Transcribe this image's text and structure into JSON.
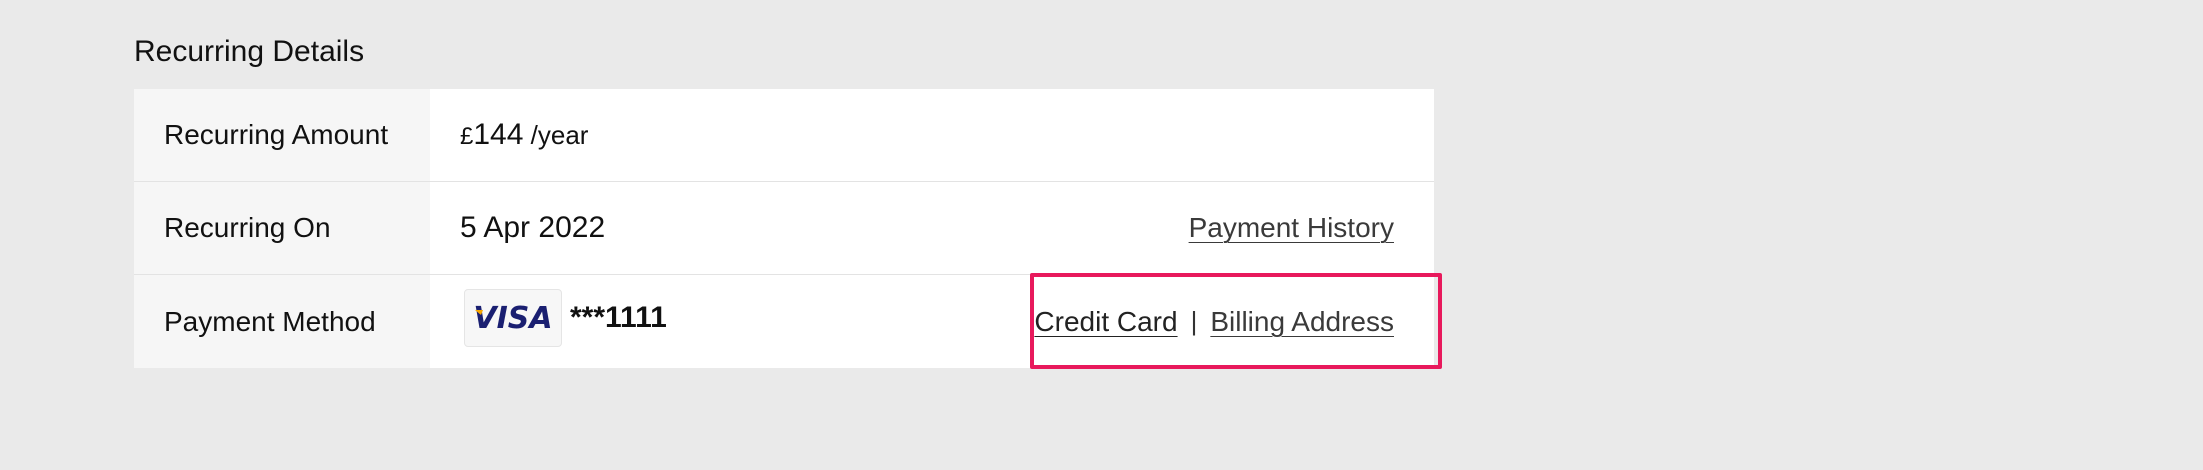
{
  "section": {
    "title": "Recurring Details"
  },
  "rows": {
    "amount": {
      "label": "Recurring Amount",
      "currency": "£",
      "value": "144",
      "period": " /year"
    },
    "recurring_on": {
      "label": "Recurring On",
      "date": "5 Apr 2022",
      "link": "Payment History"
    },
    "payment_method": {
      "label": "Payment Method",
      "card_brand": "VISA",
      "card_number": "***1111",
      "link_credit_card": "Credit Card",
      "separator": "|",
      "link_billing_address": "Billing Address"
    }
  },
  "colors": {
    "background": "#eaeaea",
    "highlight": "#e8195c",
    "visa_blue": "#1a1f71",
    "visa_gold": "#f7a600"
  }
}
